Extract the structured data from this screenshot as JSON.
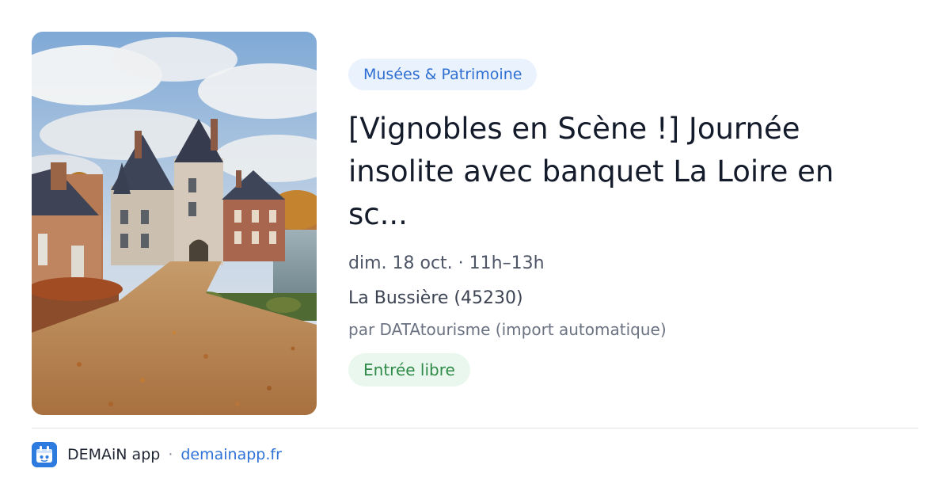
{
  "event": {
    "category": "Musées & Patrimoine",
    "title": "[Vignobles en Scène !] Journée insolite avec banquet La Loire en sc...",
    "date_time": "dim. 18 oct. · 11h–13h",
    "location": "La Bussière (45230)",
    "source": "par DATAtourisme (import automatique)",
    "price": "Entrée libre",
    "image_icon": "chateau-photo"
  },
  "footer": {
    "app_name": "DEMAiN app",
    "separator": "·",
    "url": "demainapp.fr",
    "logo_icon": "app-logo-icon"
  },
  "colors": {
    "category_bg": "#eaf2fd",
    "category_text": "#2e6fd1",
    "price_bg": "#eaf7ee",
    "price_text": "#2e8b48",
    "link": "#2e72d8",
    "logo_bg": "#2e7be0"
  }
}
